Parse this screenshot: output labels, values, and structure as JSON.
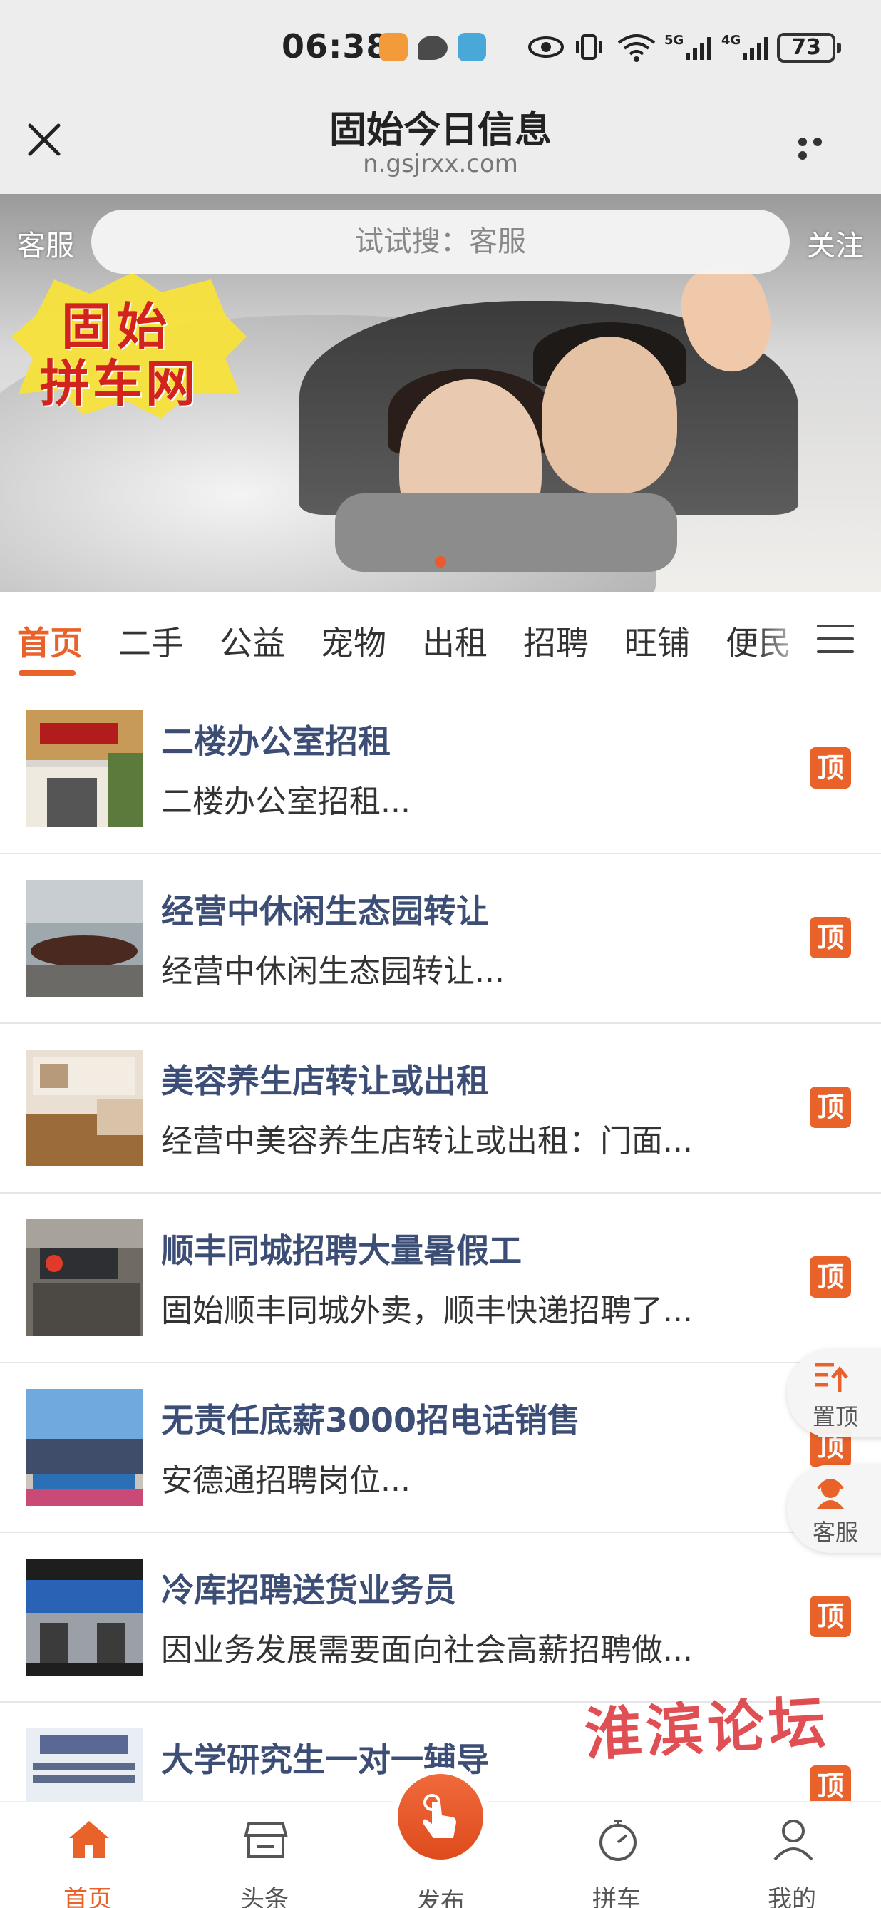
{
  "status_bar": {
    "time": "06:38",
    "battery": "73",
    "net1": "5G",
    "net2": "4G"
  },
  "title_bar": {
    "title": "固始今日信息",
    "url": "n.gsjrxx.com"
  },
  "search": {
    "left_label": "客服",
    "placeholder": "试试搜：客服",
    "right_label": "关注"
  },
  "banner": {
    "logo_line1": "固始",
    "logo_line2": "拼车网"
  },
  "tabs": [
    "首页",
    "二手",
    "公益",
    "宠物",
    "出租",
    "招聘",
    "旺铺",
    "便民"
  ],
  "list": [
    {
      "title": "二楼办公室招租",
      "desc": "二楼办公室招租...",
      "badge": "顶"
    },
    {
      "title": "经营中休闲生态园转让",
      "desc": "经营中休闲生态园转让...",
      "badge": "顶"
    },
    {
      "title": "美容养生店转让或出租",
      "desc": "经营中美容养生店转让或出租：门面...",
      "badge": "顶"
    },
    {
      "title": "顺丰同城招聘大量暑假工",
      "desc": "固始顺丰同城外卖，顺丰快递招聘了...",
      "badge": "顶"
    },
    {
      "title": "无责任底薪3000招电话销售",
      "desc": "安德通招聘岗位...",
      "badge": "顶"
    },
    {
      "title": "冷库招聘送货业务员",
      "desc": "因业务发展需要面向社会高薪招聘做...",
      "badge": "顶"
    },
    {
      "title": "大学研究生一对一辅导",
      "desc": "",
      "badge": "顶"
    }
  ],
  "float": {
    "top_label": "置顶",
    "service_label": "客服"
  },
  "watermark": "淮滨论坛",
  "bottom_nav": {
    "home": "首页",
    "headlines": "头条",
    "publish": "发布",
    "carpool": "拼车",
    "mine": "我的"
  },
  "colors": {
    "accent": "#e8622a",
    "title_blue": "#3d4e76"
  }
}
